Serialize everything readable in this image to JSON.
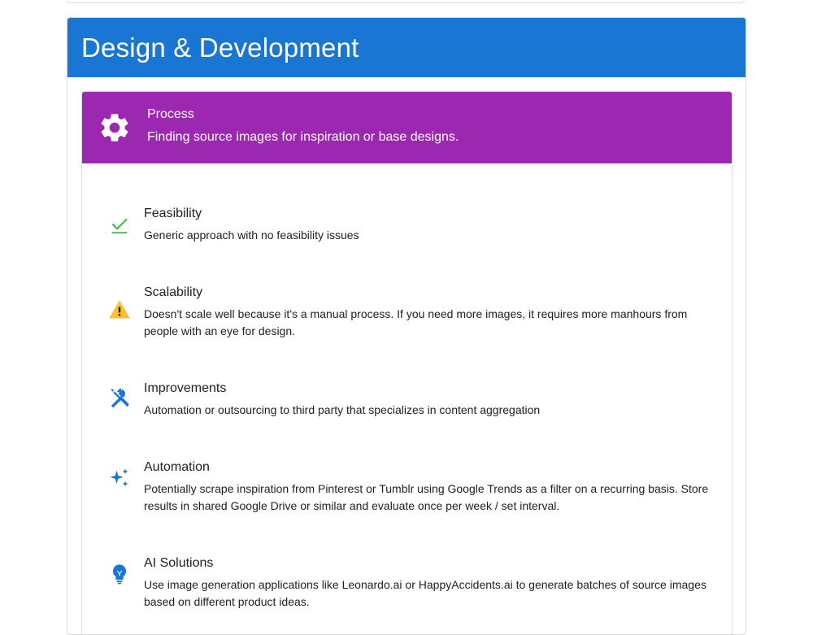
{
  "section": {
    "title": "Design & Development"
  },
  "process": {
    "title": "Process",
    "subtitle": "Finding source images for inspiration or base designs.",
    "icon": "gear-icon"
  },
  "items": [
    {
      "title": "Feasibility",
      "description": "Generic approach with no feasibility issues",
      "icon": "check-icon",
      "color": "#4caf50"
    },
    {
      "title": "Scalability",
      "description": "Doesn't scale well because it's a manual process. If you need more images, it requires more manhours from people with an eye for design.",
      "icon": "warning-icon",
      "color": "#fbc02d"
    },
    {
      "title": "Improvements",
      "description": "Automation or outsourcing to third party that specializes in content aggregation",
      "icon": "tools-icon",
      "color": "#1976d2"
    },
    {
      "title": "Automation",
      "description": "Potentially scrape inspiration from Pinterest or Tumblr using Google Trends as a filter on a recurring basis. Store results in shared Google Drive or similar and evaluate once per week / set interval.",
      "icon": "sparkle-icon",
      "color": "#1976d2"
    },
    {
      "title": "AI Solutions",
      "description": "Use image generation applications like Leonardo.ai or HappyAccidents.ai to generate batches of source images based on different product ideas.",
      "icon": "lightbulb-icon",
      "color": "#1976d2"
    }
  ],
  "colors": {
    "section_header": "#1976d2",
    "process_header": "#9c27b0"
  }
}
